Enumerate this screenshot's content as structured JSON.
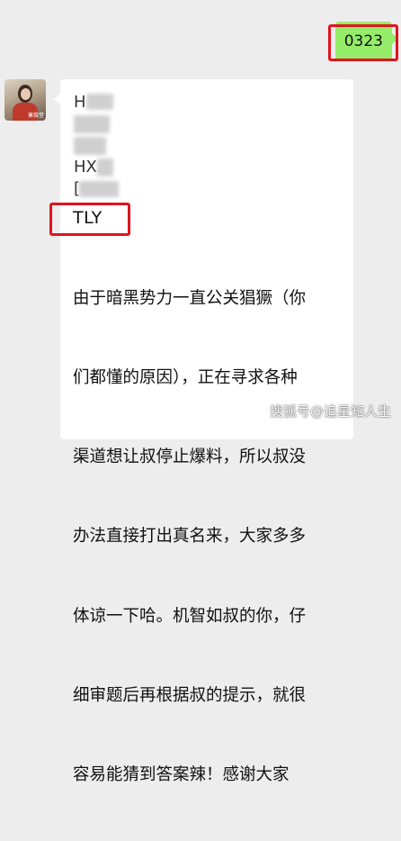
{
  "outgoing_message": {
    "text": "0323",
    "bubble_color": "#95ec69",
    "highlight_color": "#e0141e"
  },
  "incoming_message": {
    "avatar_tag": "蒹葭堂",
    "fragments": [
      "H",
      "HX.",
      "["
    ],
    "code": "TLY",
    "body_lines": [
      "由于暗黑势力一直公关猖獗（你",
      "们都懂的原因），正在寻求各种",
      "渠道想让叔停止爆料，所以叔没",
      "办法直接打出真名来，大家多多",
      "体谅一下哈。机智如叔的你，仔",
      "细审题后再根据叔的提示，就很",
      "容易能猜到答案辣！感谢大家"
    ],
    "highlight_color": "#e0141e"
  },
  "watermark": "搜狐号@追星知人生",
  "background_color": "#ededed"
}
